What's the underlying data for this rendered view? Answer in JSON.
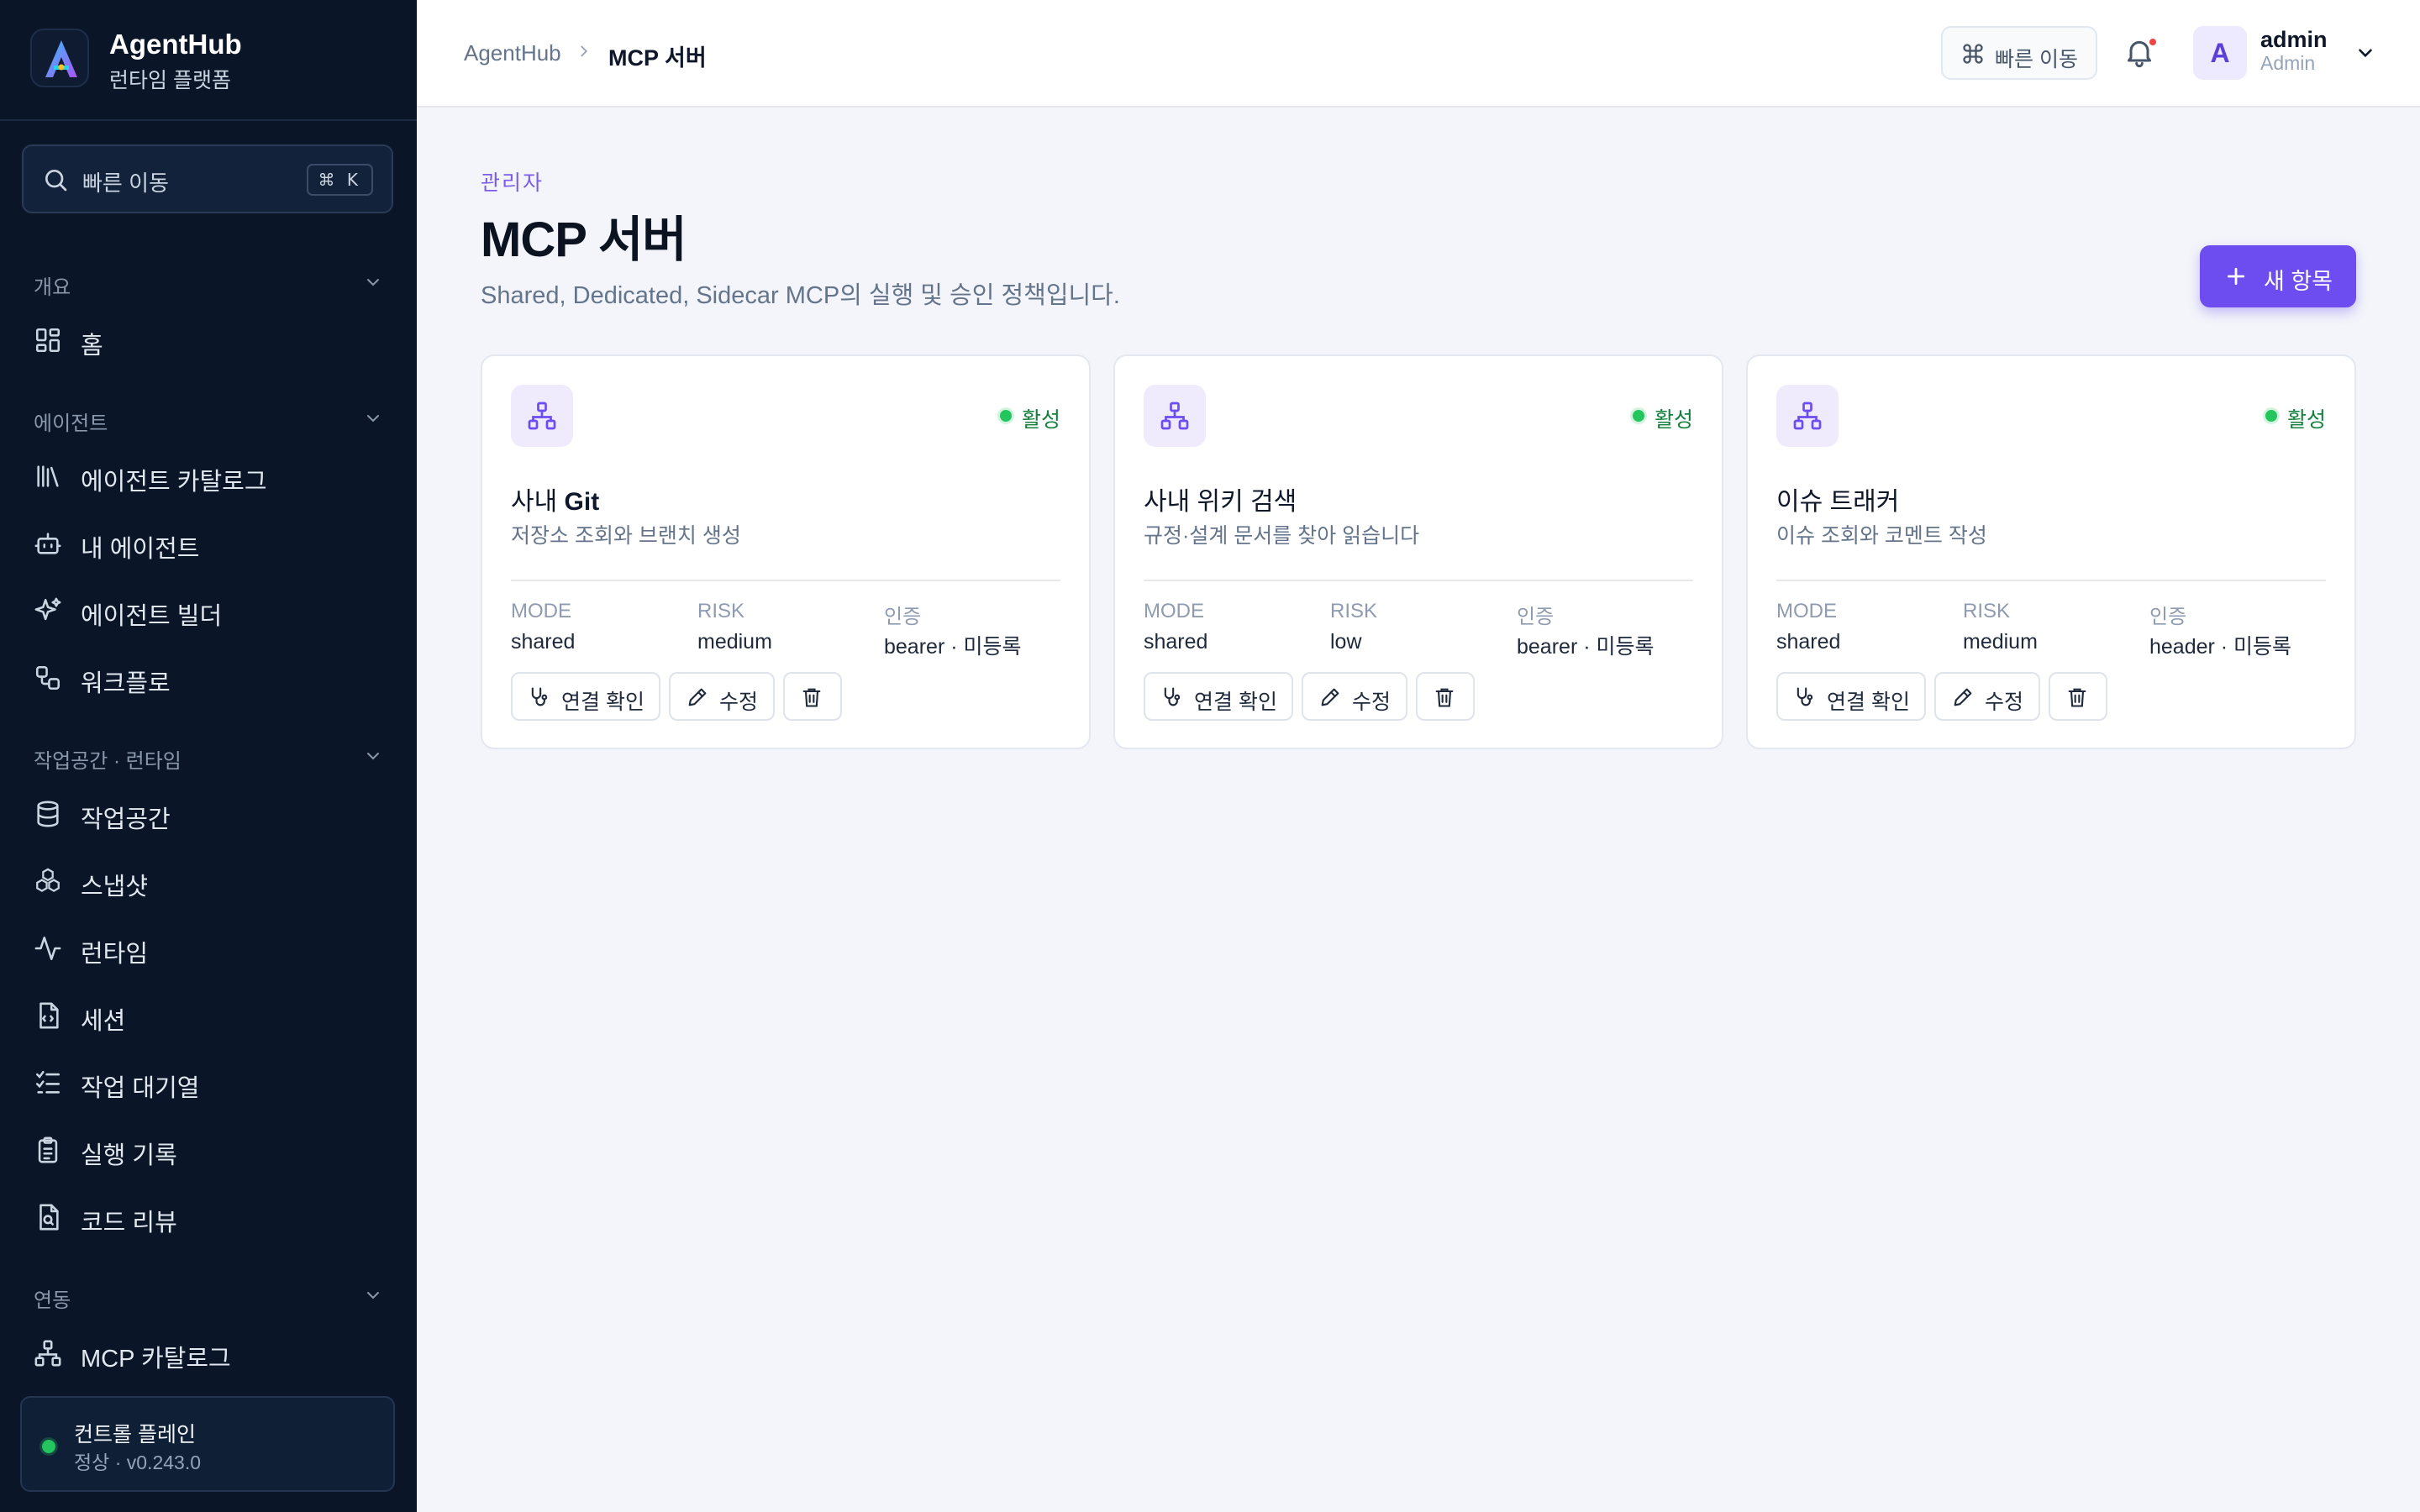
{
  "sidebar": {
    "brand_name": "AgentHub",
    "brand_sub": "런타임 플랫폼",
    "quick_search_label": "빠른 이동",
    "quick_search_kbd": "⌘ K",
    "sections": [
      {
        "label": "개요",
        "items": [
          {
            "label": "홈",
            "icon": "grid-icon"
          }
        ]
      },
      {
        "label": "에이전트",
        "items": [
          {
            "label": "에이전트 카탈로그",
            "icon": "library-icon"
          },
          {
            "label": "내 에이전트",
            "icon": "bot-icon"
          },
          {
            "label": "에이전트 빌더",
            "icon": "sparkles-icon"
          },
          {
            "label": "워크플로",
            "icon": "workflow-icon"
          }
        ]
      },
      {
        "label": "작업공간 · 런타임",
        "items": [
          {
            "label": "작업공간",
            "icon": "database-icon"
          },
          {
            "label": "스냅샷",
            "icon": "boxes-icon"
          },
          {
            "label": "런타임",
            "icon": "activity-icon"
          },
          {
            "label": "세션",
            "icon": "file-code-icon"
          },
          {
            "label": "작업 대기열",
            "icon": "list-checks-icon"
          },
          {
            "label": "실행 기록",
            "icon": "clipboard-list-icon"
          },
          {
            "label": "코드 리뷰",
            "icon": "file-search-icon"
          }
        ]
      },
      {
        "label": "연동",
        "items": [
          {
            "label": "MCP 카탈로그",
            "icon": "network-icon"
          }
        ]
      }
    ],
    "control_plane": {
      "title": "컨트롤 플레인",
      "status": "정상 · v0.243.0"
    }
  },
  "topbar": {
    "breadcrumb_root": "AgentHub",
    "breadcrumb_current": "MCP 서버",
    "quick_label": "빠른 이동",
    "avatar_letter": "A",
    "user_name": "admin",
    "user_role": "Admin"
  },
  "page": {
    "eyebrow": "관리자",
    "title": "MCP 서버",
    "description": "Shared, Dedicated, Sidecar MCP의 실행 및 승인 정책입니다.",
    "new_button": "새 항목"
  },
  "cards": [
    {
      "title_prefix": "사내 ",
      "title_bold": "Git",
      "description": "저장소 조회와 브랜치 생성",
      "status": "활성",
      "meta": [
        {
          "label": "MODE",
          "value": "shared"
        },
        {
          "label": "RISK",
          "value": "medium"
        },
        {
          "label": "인증",
          "value": "bearer · 미등록"
        }
      ],
      "actions": {
        "check": "연결 확인",
        "edit": "수정"
      }
    },
    {
      "title_prefix": "사내 위키 검색",
      "title_bold": "",
      "description": "규정·설계 문서를 찾아 읽습니다",
      "status": "활성",
      "meta": [
        {
          "label": "MODE",
          "value": "shared"
        },
        {
          "label": "RISK",
          "value": "low"
        },
        {
          "label": "인증",
          "value": "bearer · 미등록"
        }
      ],
      "actions": {
        "check": "연결 확인",
        "edit": "수정"
      }
    },
    {
      "title_prefix": "이슈 트래커",
      "title_bold": "",
      "description": "이슈 조회와 코멘트 작성",
      "status": "활성",
      "meta": [
        {
          "label": "MODE",
          "value": "shared"
        },
        {
          "label": "RISK",
          "value": "medium"
        },
        {
          "label": "인증",
          "value": "header · 미등록"
        }
      ],
      "actions": {
        "check": "연결 확인",
        "edit": "수정"
      }
    }
  ],
  "colors": {
    "sidebar_bg": "#0a1628",
    "accent": "#6d4cf0",
    "status_active": "#22c55e",
    "page_bg": "#f3f5fa"
  }
}
